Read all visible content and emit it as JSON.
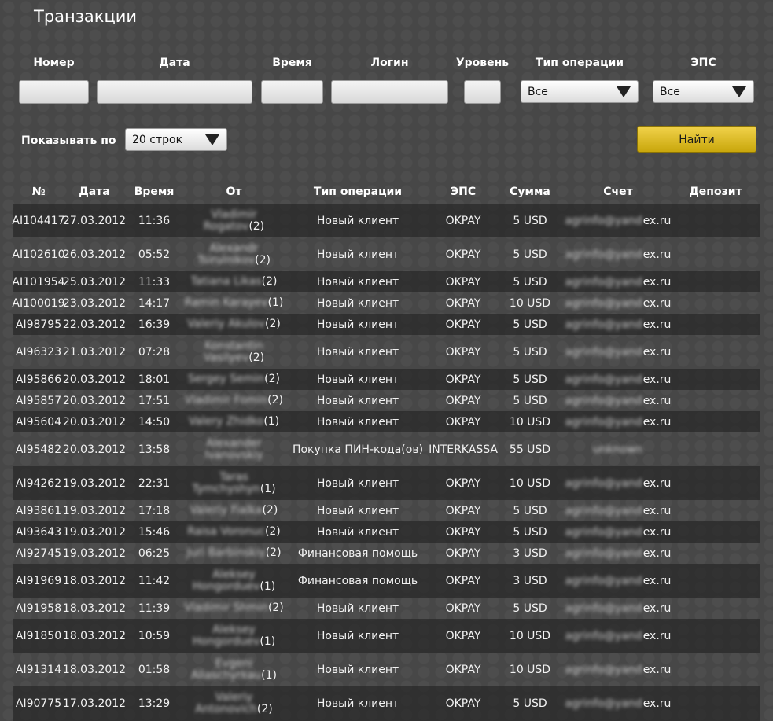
{
  "page": {
    "title": "Транзакции"
  },
  "filters": {
    "labels": [
      "Номер",
      "Дата",
      "Время",
      "Логин",
      "Уровень",
      "Тип операции",
      "ЭПС"
    ],
    "operation_type": "Все",
    "eps": "Все",
    "show_label": "Показывать по",
    "rows_per_page": "20 строк",
    "find_label": "Найти"
  },
  "table": {
    "columns": [
      "№",
      "Дата",
      "Время",
      "От",
      "Тип операции",
      "ЭПС",
      "Сумма",
      "Счет",
      "Депозит"
    ],
    "rows": [
      {
        "num": "AI104417",
        "date": "27.03.2012",
        "time": "11:36",
        "from1": "Vladimir",
        "from2": "Rogatov",
        "from_count": "(2)",
        "op": "Новый клиент",
        "eps": "OKPAY",
        "sum": "5 USD",
        "acct_hidden": "agrinfo@yand",
        "acct_visible": "ex.ru",
        "deposit": ""
      },
      {
        "num": "AI102610",
        "date": "26.03.2012",
        "time": "05:52",
        "from1": "Alexandr",
        "from2": "Tsirulnikov",
        "from_count": "(2)",
        "op": "Новый клиент",
        "eps": "OKPAY",
        "sum": "5 USD",
        "acct_hidden": "agrinfo@yand",
        "acct_visible": "ex.ru",
        "deposit": ""
      },
      {
        "num": "AI101954",
        "date": "25.03.2012",
        "time": "11:33",
        "from1": "",
        "from2": "Tatiana Likas",
        "from_count": "(2)",
        "op": "Новый клиент",
        "eps": "OKPAY",
        "sum": "5 USD",
        "acct_hidden": "agrinfo@yand",
        "acct_visible": "ex.ru",
        "deposit": ""
      },
      {
        "num": "AI100019",
        "date": "23.03.2012",
        "time": "14:17",
        "from1": "",
        "from2": "Ramin Karayev",
        "from_count": "(1)",
        "op": "Новый клиент",
        "eps": "OKPAY",
        "sum": "10 USD",
        "acct_hidden": "agrinfo@yand",
        "acct_visible": "ex.ru",
        "deposit": ""
      },
      {
        "num": "AI98795",
        "date": "22.03.2012",
        "time": "16:39",
        "from1": "",
        "from2": "Valeriy Akulov",
        "from_count": "(2)",
        "op": "Новый клиент",
        "eps": "OKPAY",
        "sum": "5 USD",
        "acct_hidden": "agrinfo@yand",
        "acct_visible": "ex.ru",
        "deposit": ""
      },
      {
        "num": "AI96323",
        "date": "21.03.2012",
        "time": "07:28",
        "from1": "Konstantin",
        "from2": "Vasilyev",
        "from_count": "(2)",
        "op": "Новый клиент",
        "eps": "OKPAY",
        "sum": "5 USD",
        "acct_hidden": "agrinfo@yand",
        "acct_visible": "ex.ru",
        "deposit": ""
      },
      {
        "num": "AI95866",
        "date": "20.03.2012",
        "time": "18:01",
        "from1": "",
        "from2": "Sergey Semin",
        "from_count": "(2)",
        "op": "Новый клиент",
        "eps": "OKPAY",
        "sum": "5 USD",
        "acct_hidden": "agrinfo@yand",
        "acct_visible": "ex.ru",
        "deposit": ""
      },
      {
        "num": "AI95857",
        "date": "20.03.2012",
        "time": "17:51",
        "from1": "",
        "from2": "Vladimir Fomin",
        "from_count": "(2)",
        "op": "Новый клиент",
        "eps": "OKPAY",
        "sum": "5 USD",
        "acct_hidden": "agrinfo@yand",
        "acct_visible": "ex.ru",
        "deposit": ""
      },
      {
        "num": "AI95604",
        "date": "20.03.2012",
        "time": "14:50",
        "from1": "",
        "from2": "Valery Zhidko",
        "from_count": "(1)",
        "op": "Новый клиент",
        "eps": "OKPAY",
        "sum": "10 USD",
        "acct_hidden": "agrinfo@yand",
        "acct_visible": "ex.ru",
        "deposit": ""
      },
      {
        "num": "AI95482",
        "date": "20.03.2012",
        "time": "13:58",
        "from1": "Alexander",
        "from2": "Ivanovskiy",
        "from_count": "",
        "op": "Покупка ПИН-кода(ов)",
        "eps": "INTERKASSA",
        "sum": "55 USD",
        "acct_hidden": "unknown",
        "acct_visible": "",
        "deposit": ""
      },
      {
        "num": "AI94262",
        "date": "19.03.2012",
        "time": "22:31",
        "from1": "Taras",
        "from2": "Tymchyshyn",
        "from_count": "(1)",
        "op": "Новый клиент",
        "eps": "OKPAY",
        "sum": "10 USD",
        "acct_hidden": "agrinfo@yand",
        "acct_visible": "ex.ru",
        "deposit": ""
      },
      {
        "num": "AI93861",
        "date": "19.03.2012",
        "time": "17:18",
        "from1": "",
        "from2": "Valeriy Fialka",
        "from_count": "(2)",
        "op": "Новый клиент",
        "eps": "OKPAY",
        "sum": "5 USD",
        "acct_hidden": "agrinfo@yand",
        "acct_visible": "ex.ru",
        "deposit": ""
      },
      {
        "num": "AI93643",
        "date": "19.03.2012",
        "time": "15:46",
        "from1": "",
        "from2": "Raisa Voronuc",
        "from_count": "(2)",
        "op": "Новый клиент",
        "eps": "OKPAY",
        "sum": "5 USD",
        "acct_hidden": "agrinfo@yand",
        "acct_visible": "ex.ru",
        "deposit": ""
      },
      {
        "num": "AI92745",
        "date": "19.03.2012",
        "time": "06:25",
        "from1": "",
        "from2": "Juri Barbinskiy",
        "from_count": "(2)",
        "op": "Финансовая помощь",
        "eps": "OKPAY",
        "sum": "3 USD",
        "acct_hidden": "agrinfo@yand",
        "acct_visible": "ex.ru",
        "deposit": ""
      },
      {
        "num": "AI91969",
        "date": "18.03.2012",
        "time": "11:42",
        "from1": "Aleksey",
        "from2": "Hongorduev",
        "from_count": "(1)",
        "op": "Финансовая помощь",
        "eps": "OKPAY",
        "sum": "3 USD",
        "acct_hidden": "agrinfo@yand",
        "acct_visible": "ex.ru",
        "deposit": ""
      },
      {
        "num": "AI91958",
        "date": "18.03.2012",
        "time": "11:39",
        "from1": "",
        "from2": "Vladimir Shmin",
        "from_count": "(2)",
        "op": "Новый клиент",
        "eps": "OKPAY",
        "sum": "5 USD",
        "acct_hidden": "agrinfo@yand",
        "acct_visible": "ex.ru",
        "deposit": ""
      },
      {
        "num": "AI91850",
        "date": "18.03.2012",
        "time": "10:59",
        "from1": "Aleksey",
        "from2": "Hongorduev",
        "from_count": "(1)",
        "op": "Новый клиент",
        "eps": "OKPAY",
        "sum": "10 USD",
        "acct_hidden": "agrinfo@yand",
        "acct_visible": "ex.ru",
        "deposit": ""
      },
      {
        "num": "AI91314",
        "date": "18.03.2012",
        "time": "01:58",
        "from1": "Evgeni",
        "from2": "Aliaschyrkau",
        "from_count": "(1)",
        "op": "Новый клиент",
        "eps": "OKPAY",
        "sum": "10 USD",
        "acct_hidden": "agrinfo@yand",
        "acct_visible": "ex.ru",
        "deposit": ""
      },
      {
        "num": "AI90775",
        "date": "17.03.2012",
        "time": "13:29",
        "from1": "Valeriy",
        "from2": "Antonovich",
        "from_count": "(2)",
        "op": "Новый клиент",
        "eps": "OKPAY",
        "sum": "5 USD",
        "acct_hidden": "agrinfo@yand",
        "acct_visible": "ex.ru",
        "deposit": ""
      }
    ]
  }
}
